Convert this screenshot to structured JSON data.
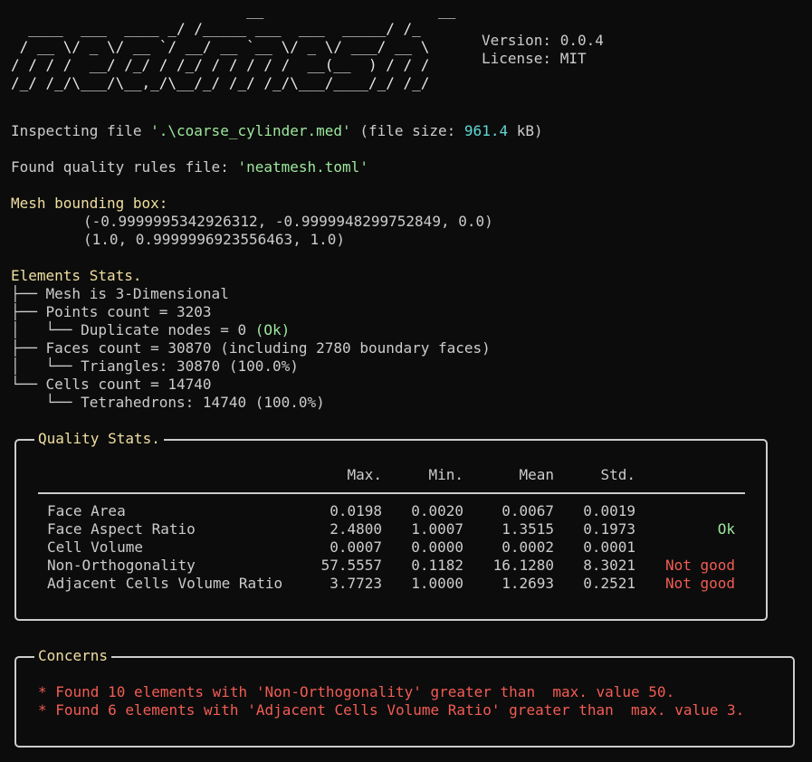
{
  "banner": {
    "art": [
      "                           __                    __",
      "  ____  ___  ____ _/ /_____ ___  ___  _____/ /_",
      " / __ \\/ _ \\/ __ `/ __/ __ `__ \\/ _ \\/ ___/ __ \\",
      "/ / / /  __/ /_/ / /_/ / / / / /  __(__  ) / / /",
      "/_/ /_/\\___/\\__,_/\\__/_/ /_/ /_/\\___/____/_/ /_/"
    ],
    "version_label": "Version:",
    "version": "0.0.4",
    "license_label": "License:",
    "license": "MIT"
  },
  "inspect": {
    "prefix": "Inspecting file ",
    "filename": "'.\\coarse_cylinder.med'",
    "size_prefix": " (file size: ",
    "size_value": "961.4",
    "size_unit": " kB)"
  },
  "rules": {
    "prefix": "Found quality rules file: ",
    "filename": "'neatmesh.toml'"
  },
  "bbox": {
    "title": "Mesh bounding box:",
    "min": "(-0.9999995342926312, -0.9999948299752849, 0.0)",
    "max": "(1.0, 0.9999996923556463, 1.0)"
  },
  "elements": {
    "title": "Elements Stats.",
    "tree": [
      {
        "prefix": "├── ",
        "text": "Mesh is 3-Dimensional",
        "suffix": ""
      },
      {
        "prefix": "├── ",
        "text": "Points count = 3203",
        "suffix": ""
      },
      {
        "prefix": "│   └── ",
        "text": "Duplicate nodes = 0 ",
        "suffix": "(Ok)"
      },
      {
        "prefix": "├── ",
        "text": "Faces count = 30870 (including 2780 boundary faces)",
        "suffix": ""
      },
      {
        "prefix": "│   └── ",
        "text": "Triangles: 30870 (100.0%)",
        "suffix": ""
      },
      {
        "prefix": "└── ",
        "text": "Cells count = 14740",
        "suffix": ""
      },
      {
        "prefix": "    └── ",
        "text": "Tetrahedrons: 14740 (100.0%)",
        "suffix": ""
      }
    ]
  },
  "quality": {
    "title": "Quality Stats.",
    "headers": [
      "Max.",
      "Min.",
      "Mean",
      "Std."
    ],
    "rows": [
      {
        "name": "Face Area",
        "max": "0.0198",
        "min": "0.0020",
        "mean": "0.0067",
        "std": "0.0019",
        "status": "",
        "status_color": ""
      },
      {
        "name": "Face Aspect Ratio",
        "max": "2.4800",
        "min": "1.0007",
        "mean": "1.3515",
        "std": "0.1973",
        "status": "Ok",
        "status_color": "#9ee89e"
      },
      {
        "name": "Cell Volume",
        "max": "0.0007",
        "min": "0.0000",
        "mean": "0.0002",
        "std": "0.0001",
        "status": "",
        "status_color": ""
      },
      {
        "name": "Non-Orthogonality",
        "max": "57.5557",
        "min": "0.1182",
        "mean": "16.1280",
        "std": "8.3021",
        "status": "Not good",
        "status_color": "#f25c54"
      },
      {
        "name": "Adjacent Cells Volume Ratio",
        "max": "3.7723",
        "min": "1.0000",
        "mean": "1.2693",
        "std": "0.2521",
        "status": "Not good",
        "status_color": "#f25c54"
      }
    ]
  },
  "concerns": {
    "title": "Concerns",
    "items": [
      "* Found 10 elements with 'Non-Orthogonality' greater than  max. value 50.",
      "* Found 6 elements with 'Adjacent Cells Volume Ratio' greater than  max. value 3."
    ]
  },
  "colors": {
    "background": "#0c0c0c",
    "foreground": "#cccccc",
    "heading": "#f0dfa0",
    "cyan": "#61d6d6",
    "green": "#9ee89e",
    "red": "#f25c54"
  }
}
